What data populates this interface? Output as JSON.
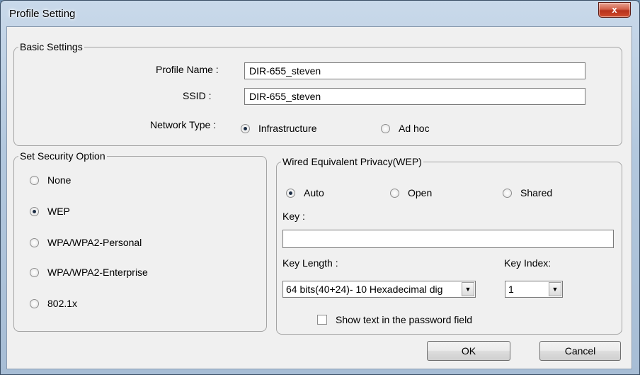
{
  "window": {
    "title": "Profile Setting",
    "close_glyph": "x"
  },
  "basic": {
    "legend": "Basic Settings",
    "profile_name_label": "Profile Name :",
    "profile_name_value": "DIR-655_steven",
    "ssid_label": "SSID :",
    "ssid_value": "DIR-655_steven",
    "network_type_label": "Network Type :",
    "network_types": [
      {
        "label": "Infrastructure",
        "selected": true
      },
      {
        "label": "Ad hoc",
        "selected": false
      }
    ]
  },
  "security": {
    "legend": "Set Security Option",
    "options": [
      {
        "label": "None",
        "selected": false
      },
      {
        "label": "WEP",
        "selected": true
      },
      {
        "label": "WPA/WPA2-Personal",
        "selected": false
      },
      {
        "label": "WPA/WPA2-Enterprise",
        "selected": false
      },
      {
        "label": "802.1x",
        "selected": false
      }
    ]
  },
  "wep": {
    "legend": "Wired Equivalent Privacy(WEP)",
    "auth_modes": [
      {
        "label": "Auto",
        "selected": true
      },
      {
        "label": "Open",
        "selected": false
      },
      {
        "label": "Shared",
        "selected": false
      }
    ],
    "key_label": "Key :",
    "key_value": "",
    "key_length_label": "Key Length :",
    "key_length_value": "64 bits(40+24)- 10 Hexadecimal dig",
    "key_index_label": "Key Index:",
    "key_index_value": "1",
    "show_text_label": "Show text in the password field",
    "show_text_checked": false
  },
  "buttons": {
    "ok": "OK",
    "cancel": "Cancel"
  },
  "icons": {
    "dropdown": "chevron-down-icon",
    "close": "close-icon"
  }
}
